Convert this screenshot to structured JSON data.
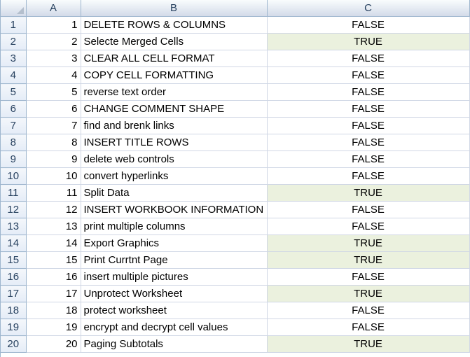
{
  "columns": {
    "a": "A",
    "b": "B",
    "c": "C"
  },
  "colors": {
    "true_fill": "#ebf1de",
    "header_fill": "#dde4ee",
    "gridline": "#d0d7e5"
  },
  "rows": [
    {
      "row": "1",
      "a": "1",
      "b": "DELETE ROWS & COLUMNS",
      "c": "FALSE"
    },
    {
      "row": "2",
      "a": "2",
      "b": "Selecte Merged Cells",
      "c": "TRUE"
    },
    {
      "row": "3",
      "a": "3",
      "b": "CLEAR ALL CELL FORMAT",
      "c": "FALSE"
    },
    {
      "row": "4",
      "a": "4",
      "b": "COPY CELL FORMATTING",
      "c": "FALSE"
    },
    {
      "row": "5",
      "a": "5",
      "b": "reverse text order",
      "c": "FALSE"
    },
    {
      "row": "6",
      "a": "6",
      "b": "CHANGE COMMENT SHAPE",
      "c": "FALSE"
    },
    {
      "row": "7",
      "a": "7",
      "b": "find and brenk links",
      "c": "FALSE"
    },
    {
      "row": "8",
      "a": "8",
      "b": "INSERT TITLE ROWS",
      "c": "FALSE"
    },
    {
      "row": "9",
      "a": "9",
      "b": "delete web controls",
      "c": "FALSE"
    },
    {
      "row": "10",
      "a": "10",
      "b": "convert hyperlinks",
      "c": "FALSE"
    },
    {
      "row": "11",
      "a": "11",
      "b": "Split Data",
      "c": "TRUE"
    },
    {
      "row": "12",
      "a": "12",
      "b": "INSERT WORKBOOK INFORMATION",
      "c": "FALSE"
    },
    {
      "row": "13",
      "a": "13",
      "b": "print multiple columns",
      "c": "FALSE"
    },
    {
      "row": "14",
      "a": "14",
      "b": "Export Graphics",
      "c": "TRUE"
    },
    {
      "row": "15",
      "a": "15",
      "b": "Print Currtnt Page",
      "c": "TRUE"
    },
    {
      "row": "16",
      "a": "16",
      "b": "insert multiple pictures",
      "c": "FALSE"
    },
    {
      "row": "17",
      "a": "17",
      "b": "Unprotect Worksheet",
      "c": "TRUE"
    },
    {
      "row": "18",
      "a": "18",
      "b": "protect worksheet",
      "c": "FALSE"
    },
    {
      "row": "19",
      "a": "19",
      "b": "encrypt and decrypt cell values",
      "c": "FALSE"
    },
    {
      "row": "20",
      "a": "20",
      "b": "Paging Subtotals",
      "c": "TRUE"
    }
  ]
}
